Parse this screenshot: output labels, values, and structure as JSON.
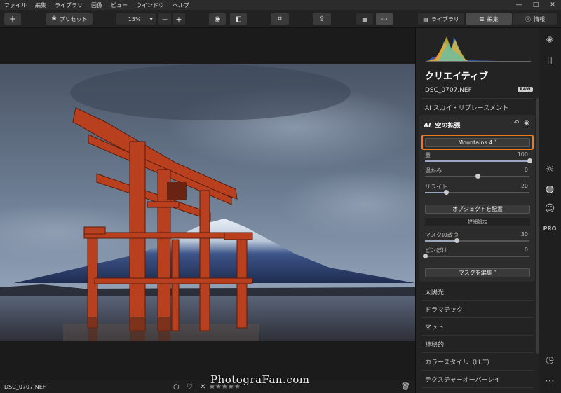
{
  "menu": [
    "ファイル",
    "編集",
    "ライブラリ",
    "画像",
    "ビュー",
    "ウインドウ",
    "ヘルプ"
  ],
  "window_controls": [
    "—",
    "□",
    "✕"
  ],
  "toolbar": {
    "add_label": "+",
    "presets_label": "プリセット",
    "zoom_value": "15%",
    "zoom_minus": "—",
    "zoom_plus": "+",
    "library_tab": "ライブラリ",
    "edit_tab": "編集",
    "info_tab": "情報"
  },
  "panel": {
    "title": "クリエイティブ",
    "filename": "DSC_0707.NEF",
    "raw_badge": "RAW",
    "ai_sky_section": "AI スカイ・リプレースメント",
    "card_title": "空の拡張",
    "card_ai_mark": "AI",
    "sky_dropdown": "Mountains 4 ˅",
    "sliders": [
      {
        "label": "量",
        "value": "100",
        "level": 1.0
      },
      {
        "label": "温かみ",
        "value": "0",
        "level": 0.5
      },
      {
        "label": "リライト",
        "value": "20",
        "level": 0.2
      }
    ],
    "place_objects_button": "オブジェクトを配置",
    "advanced_settings": "詳細設定",
    "mask_sliders": [
      {
        "label": "マスクの改良",
        "value": "30",
        "level": 0.3
      },
      {
        "label": "ピンぼけ",
        "value": "0",
        "level": 0.0
      }
    ],
    "edit_mask_button": "マスクを編集 ˅",
    "sections": [
      "太陽光",
      "ドラマチック",
      "マット",
      "神秘的",
      "カラースタイル（LUT）",
      "テクスチャーオーバーレイ"
    ]
  },
  "bottom": {
    "filename": "DSC_0707.NEF",
    "stars": "★★★★★",
    "reject": "✕",
    "heart": "♡",
    "circle": "○"
  },
  "watermark": "PhotograFan.com",
  "colors": {
    "highlight": "#f07a1a",
    "torii": "#b8401f",
    "sky": "#5a6a7f"
  }
}
